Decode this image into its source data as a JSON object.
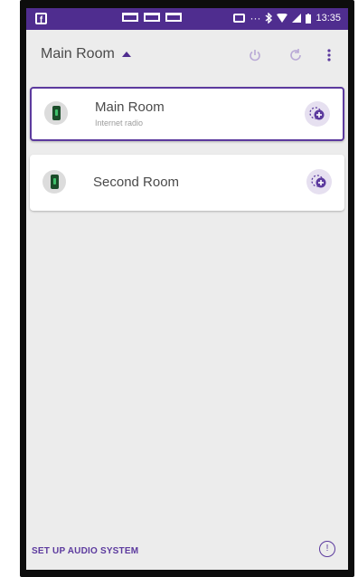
{
  "status_bar": {
    "time": "13:35",
    "dots": "···"
  },
  "app_bar": {
    "room_title": "Main Room",
    "power_icon": "power-icon",
    "refresh_icon": "refresh-icon",
    "more_icon": "more-vert-icon"
  },
  "rooms": [
    {
      "name": "Main Room",
      "subtitle": "Internet radio",
      "selected": true
    },
    {
      "name": "Second Room",
      "subtitle": "",
      "selected": false
    }
  ],
  "footer": {
    "setup_label": "SET UP AUDIO SYSTEM",
    "info_label": "!"
  },
  "colors": {
    "accent": "#5c3a9e",
    "status_bar": "#4f2d8f",
    "background": "#ececec"
  }
}
